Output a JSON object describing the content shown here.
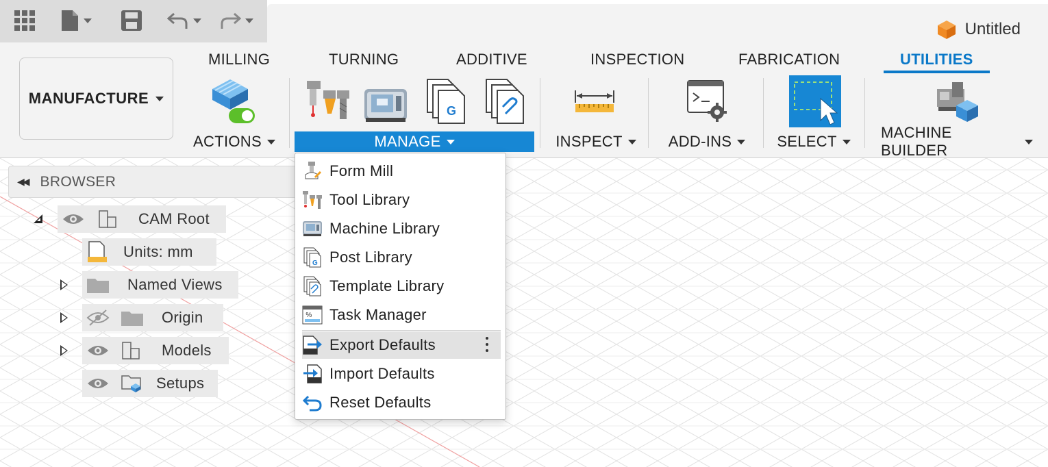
{
  "qat": {
    "icons": [
      "grid-icon",
      "file-icon",
      "save-icon",
      "undo-icon",
      "redo-icon"
    ]
  },
  "document": {
    "title": "Untitled"
  },
  "workspace": {
    "label": "MANUFACTURE"
  },
  "tabs": [
    {
      "label": "MILLING",
      "active": false
    },
    {
      "label": "TURNING",
      "active": false
    },
    {
      "label": "ADDITIVE",
      "active": false
    },
    {
      "label": "INSPECTION",
      "active": false
    },
    {
      "label": "FABRICATION",
      "active": false
    },
    {
      "label": "UTILITIES",
      "active": true
    }
  ],
  "groups": {
    "actions": "ACTIONS",
    "manage": "MANAGE",
    "inspect": "INSPECT",
    "addins": "ADD-INS",
    "select": "SELECT",
    "machine_builder": "MACHINE BUILDER"
  },
  "browser": {
    "title": "BROWSER",
    "root": "CAM Root",
    "items": [
      {
        "label": "Units: mm"
      },
      {
        "label": "Named Views"
      },
      {
        "label": "Origin"
      },
      {
        "label": "Models"
      },
      {
        "label": "Setups"
      }
    ]
  },
  "manage_menu": {
    "items": [
      {
        "label": "Form Mill",
        "icon": "form-mill-icon"
      },
      {
        "label": "Tool Library",
        "icon": "tool-library-icon"
      },
      {
        "label": "Machine Library",
        "icon": "machine-library-icon"
      },
      {
        "label": "Post Library",
        "icon": "post-library-icon"
      },
      {
        "label": "Template Library",
        "icon": "template-library-icon"
      },
      {
        "label": "Task Manager",
        "icon": "task-manager-icon"
      },
      {
        "label": "Export Defaults",
        "icon": "export-icon",
        "highlighted": true
      },
      {
        "label": "Import Defaults",
        "icon": "import-icon"
      },
      {
        "label": "Reset Defaults",
        "icon": "reset-icon"
      }
    ]
  },
  "colors": {
    "accent": "#0a78c8",
    "manage_active": "#1787d4",
    "select_button": "#1787d4",
    "actions_toggle": "#5cbf2a",
    "cube_orange": "#f08a24"
  }
}
